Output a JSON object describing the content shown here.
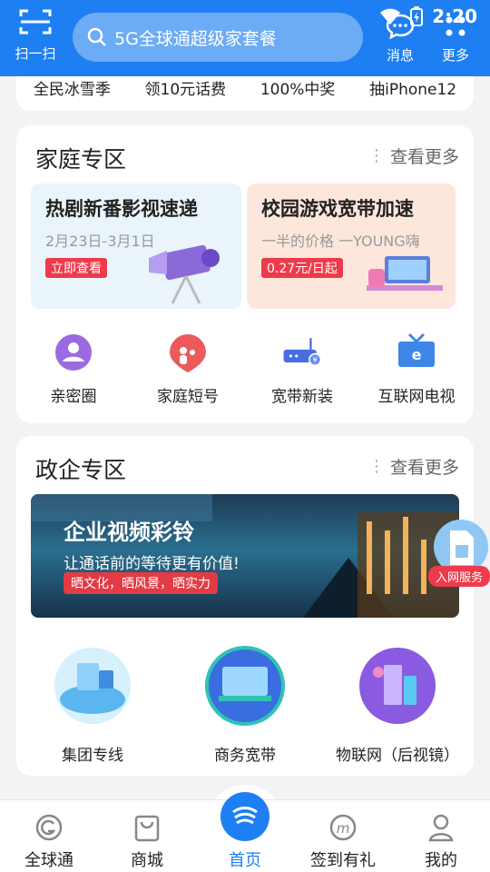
{
  "status": {
    "time": "2:20"
  },
  "header": {
    "scan_label": "扫一扫",
    "search_placeholder": "5G全球通超级家套餐",
    "messages_label": "消息",
    "more_label": "更多"
  },
  "promo_strip": [
    "全民冰雪季",
    "领10元话费",
    "100%中奖",
    "抽iPhone12"
  ],
  "family": {
    "title": "家庭专区",
    "more": "查看更多",
    "banner_left": {
      "title": "热剧新番影视速递",
      "subtitle": "2月23日-3月1日",
      "tag": "立即查看"
    },
    "banner_right": {
      "title": "校园游戏宽带加速",
      "subtitle": "一半的价格 一YOUNG嗨",
      "tag": "0.27元/日起"
    },
    "items": [
      {
        "label": "亲密圈",
        "icon": "people-circle-icon"
      },
      {
        "label": "家庭短号",
        "icon": "family-phone-icon"
      },
      {
        "label": "宽带新装",
        "icon": "router-icon"
      },
      {
        "label": "互联网电视",
        "icon": "tv-icon"
      }
    ]
  },
  "enterprise": {
    "title": "政企专区",
    "more": "查看更多",
    "banner": {
      "title": "企业视频彩铃",
      "line2": "让通话前的等待更有价值!",
      "line3": "晒文化，晒风景，晒实力"
    },
    "items": [
      {
        "label": "集团专线",
        "icon": "dedicated-line-icon"
      },
      {
        "label": "商务宽带",
        "icon": "business-broadband-icon"
      },
      {
        "label": "物联网（后视镜）",
        "icon": "iot-icon"
      }
    ]
  },
  "float_service": {
    "label": "入网服务"
  },
  "tabs": [
    {
      "label": "全球通",
      "icon": "global-icon"
    },
    {
      "label": "商城",
      "icon": "shopping-bag-icon"
    },
    {
      "label": "首页",
      "icon": "home-logo-icon"
    },
    {
      "label": "签到有礼",
      "icon": "checkin-icon"
    },
    {
      "label": "我的",
      "icon": "profile-icon"
    }
  ],
  "colors": {
    "primary": "#1e7ff2",
    "accent_red": "#ee3b4b"
  }
}
